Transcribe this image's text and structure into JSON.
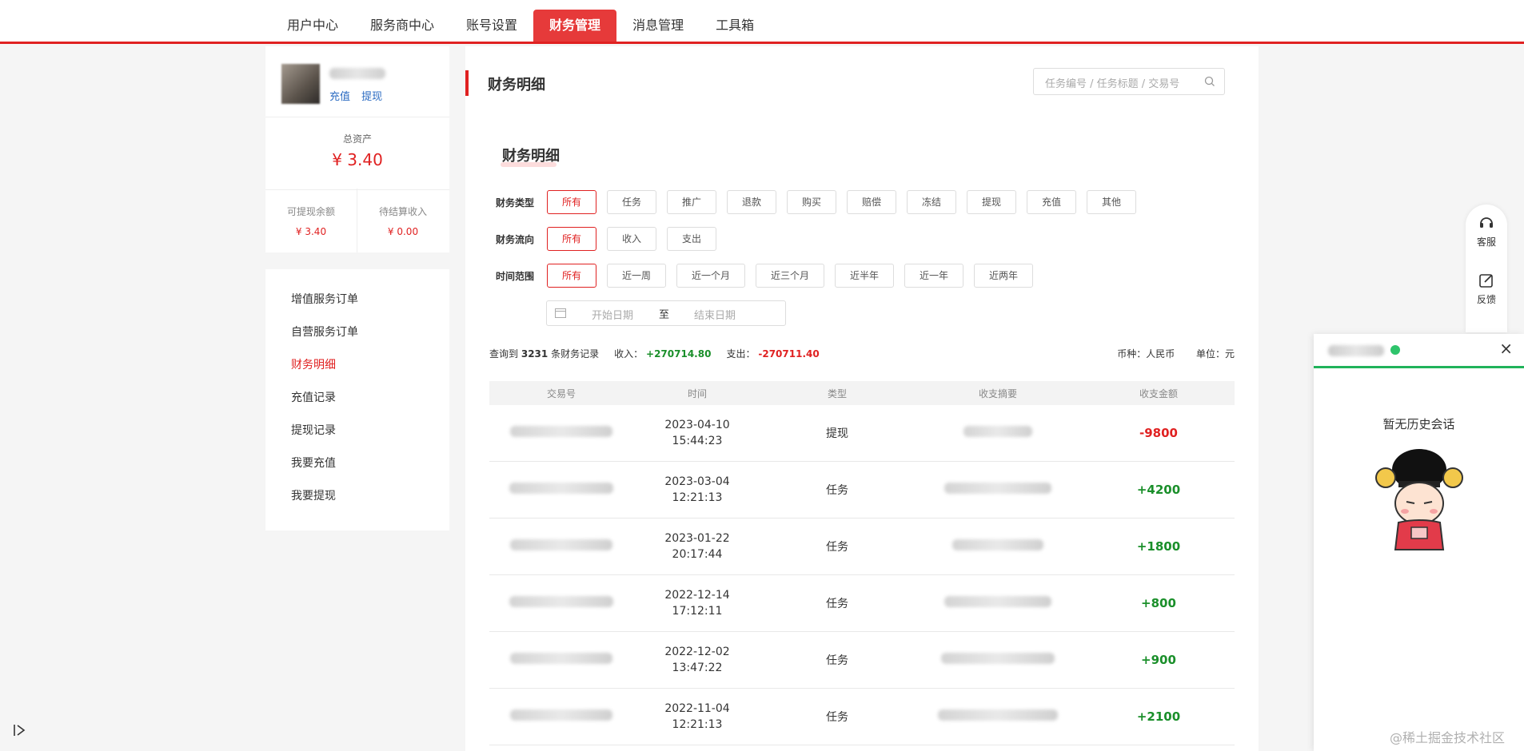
{
  "nav": {
    "tabs": [
      {
        "label": "用户中心"
      },
      {
        "label": "服务商中心"
      },
      {
        "label": "账号设置"
      },
      {
        "label": "财务管理"
      },
      {
        "label": "消息管理"
      },
      {
        "label": "工具箱"
      }
    ],
    "active": "财务管理"
  },
  "profile": {
    "link_recharge": "充值",
    "link_withdraw": "提现",
    "total_label": "总资产",
    "total_value": "¥ 3.40",
    "withdrawable_label": "可提现余额",
    "withdrawable_value": "¥ 3.40",
    "pending_label": "待结算收入",
    "pending_value": "¥ 0.00"
  },
  "menu": {
    "items": [
      {
        "label": "增值服务订单"
      },
      {
        "label": "自营服务订单"
      },
      {
        "label": "财务明细"
      },
      {
        "label": "充值记录"
      },
      {
        "label": "提现记录"
      },
      {
        "label": "我要充值"
      },
      {
        "label": "我要提现"
      }
    ],
    "active": "财务明细"
  },
  "main": {
    "page_title": "财务明细",
    "search_placeholder": "任务编号 / 任务标题 / 交易号",
    "section_title": "财务明细"
  },
  "filters": {
    "type": {
      "label": "财务类型",
      "options": [
        "所有",
        "任务",
        "推广",
        "退款",
        "购买",
        "赔偿",
        "冻结",
        "提现",
        "充值",
        "其他"
      ],
      "selected": "所有"
    },
    "flow": {
      "label": "财务流向",
      "options": [
        "所有",
        "收入",
        "支出"
      ],
      "selected": "所有"
    },
    "time": {
      "label": "时间范围",
      "options": [
        "所有",
        "近一周",
        "近一个月",
        "近三个月",
        "近半年",
        "近一年",
        "近两年"
      ],
      "selected": "所有"
    },
    "date_start_placeholder": "开始日期",
    "date_sep": "至",
    "date_end_placeholder": "结束日期"
  },
  "summary": {
    "prefix": "查询到",
    "count": "3231",
    "suffix": "条财务记录",
    "income_label": "收入：",
    "income_value": "+270714.80",
    "expense_label": "支出：",
    "expense_value": "-270711.40",
    "currency_label": "币种：人民币",
    "unit_label": "单位：元"
  },
  "table": {
    "headers": [
      "交易号",
      "时间",
      "类型",
      "收支摘要",
      "收支金额"
    ],
    "rows": [
      {
        "date": "2023-04-10",
        "time": "15:44:23",
        "type": "提现",
        "amount": "-9800",
        "sign": "neg"
      },
      {
        "date": "2023-03-04",
        "time": "12:21:13",
        "type": "任务",
        "amount": "+4200",
        "sign": "pos"
      },
      {
        "date": "2023-01-22",
        "time": "20:17:44",
        "type": "任务",
        "amount": "+1800",
        "sign": "pos"
      },
      {
        "date": "2022-12-14",
        "time": "17:12:11",
        "type": "任务",
        "amount": "+800",
        "sign": "pos"
      },
      {
        "date": "2022-12-02",
        "time": "13:47:22",
        "type": "任务",
        "amount": "+900",
        "sign": "pos"
      },
      {
        "date": "2022-11-04",
        "time": "12:21:13",
        "type": "任务",
        "amount": "+2100",
        "sign": "pos"
      }
    ]
  },
  "float": {
    "service_label": "客服",
    "feedback_label": "反馈"
  },
  "chat": {
    "empty_text": "暂无历史会话",
    "close_symbol": "×"
  },
  "watermark": "@稀土掘金技术社区",
  "colors": {
    "brand_red": "#e02121",
    "income_green": "#1a8f2a",
    "online_green": "#2ec46b"
  }
}
